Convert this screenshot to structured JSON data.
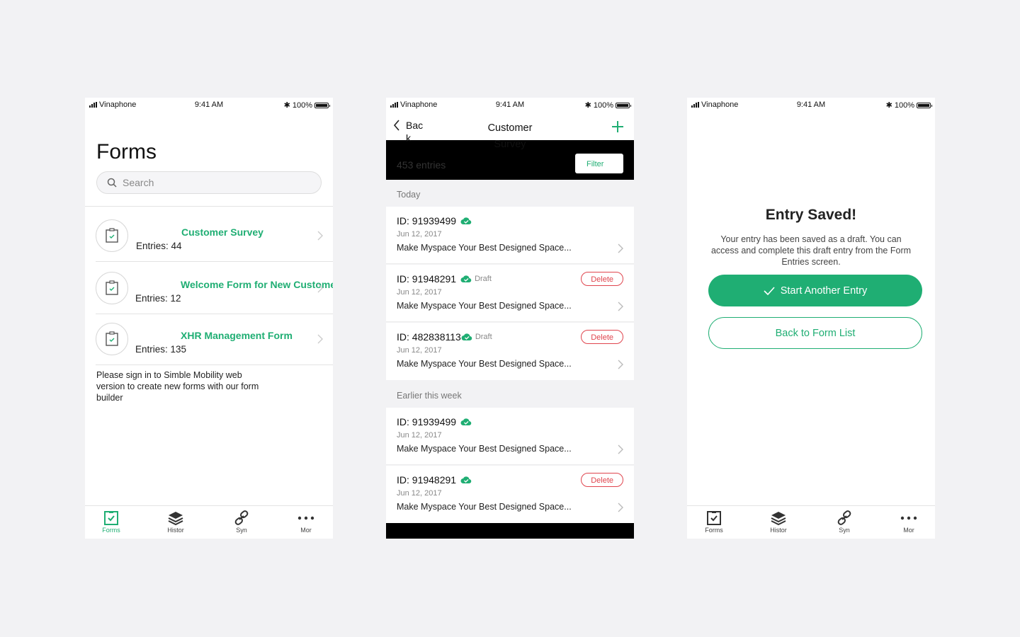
{
  "status": {
    "carrier": "Vinaphone",
    "time": "9:41 AM",
    "battery": "100%"
  },
  "brand_color": "#1fae73",
  "danger_color": "#e0454e",
  "forms_screen": {
    "title": "Forms",
    "search_placeholder": "Search",
    "items": [
      {
        "name": "Customer Survey",
        "entries": "Entries: 44"
      },
      {
        "name": "Welcome Form for New Customer",
        "entries": "Entries: 12"
      },
      {
        "name": "XHR Management Form",
        "entries": "Entries: 135"
      }
    ],
    "note": "Please sign in to Simble Mobility web version to create new forms with our form builder"
  },
  "tabbar": {
    "tabs": [
      {
        "label": "Forms",
        "icon": "form-clipboard-icon"
      },
      {
        "label": "Histor",
        "icon": "layers-icon"
      },
      {
        "label": "Syn",
        "icon": "link-icon"
      },
      {
        "label": "Mor",
        "icon": "more-dots-icon"
      }
    ]
  },
  "entries_screen": {
    "back_label": "Back",
    "title": "Customer Survey",
    "count": "453 entries",
    "filter_label": "Filter",
    "sections": [
      {
        "label": "Today"
      },
      {
        "label": "Earlier this week"
      }
    ],
    "entries": [
      {
        "id": "ID: 91939499",
        "draft": "",
        "date": "Jun 12, 2017",
        "desc": "Make Myspace Your Best Designed Space...",
        "delete": ""
      },
      {
        "id": "ID: 91948291",
        "draft": "Draft",
        "date": "Jun 12, 2017",
        "desc": "Make Myspace Your Best Designed Space...",
        "delete": "Delete"
      },
      {
        "id": "ID: 482838113",
        "draft": "Draft",
        "date": "Jun 12, 2017",
        "desc": "Make Myspace Your Best Designed Space...",
        "delete": "Delete"
      },
      {
        "id": "ID: 91939499",
        "draft": "",
        "date": "Jun 12, 2017",
        "desc": "Make Myspace Your Best Designed Space...",
        "delete": ""
      },
      {
        "id": "ID: 91948291",
        "draft": "",
        "date": "Jun 12, 2017",
        "desc": "Make Myspace Your Best Designed Space...",
        "delete": "Delete"
      }
    ]
  },
  "saved_screen": {
    "title": "Entry Saved!",
    "message": "Your entry has been saved as a draft. You can access and complete this draft entry from the Form Entries screen.",
    "primary_button": "Start Another Entry",
    "secondary_button": "Back to Form List"
  }
}
